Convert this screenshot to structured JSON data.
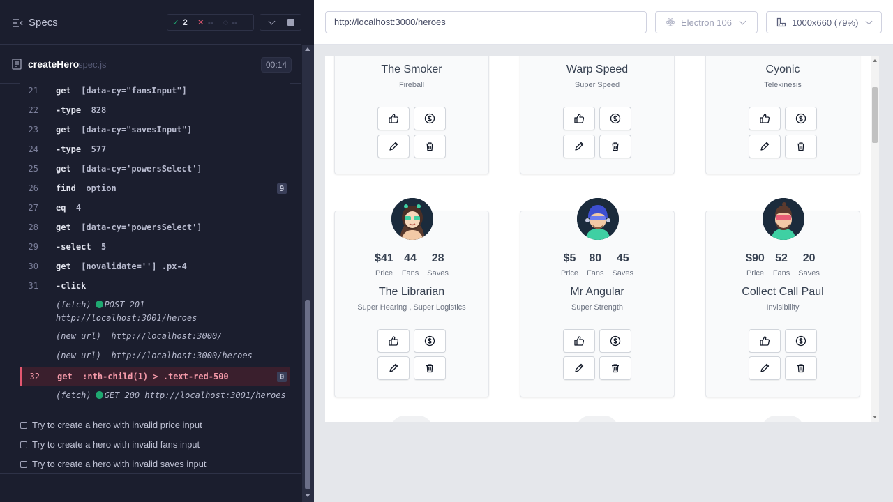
{
  "reporter": {
    "specs_label": "Specs",
    "stats": {
      "passed": "2",
      "failed": "--",
      "pending": "--"
    },
    "spec": {
      "name": "createHero",
      "ext": "spec.js",
      "time": "00:14"
    },
    "commands": [
      {
        "num": "21",
        "name": "get",
        "msg": "[data-cy=\"fansInput\"]"
      },
      {
        "num": "22",
        "name": "-type",
        "msg": "828"
      },
      {
        "num": "23",
        "name": "get",
        "msg": "[data-cy=\"savesInput\"]"
      },
      {
        "num": "24",
        "name": "-type",
        "msg": "577"
      },
      {
        "num": "25",
        "name": "get",
        "msg": "[data-cy='powersSelect']"
      },
      {
        "num": "26",
        "name": "find",
        "msg": "option",
        "badge": "9"
      },
      {
        "num": "27",
        "name": "eq",
        "msg": "4"
      },
      {
        "num": "28",
        "name": "get",
        "msg": "[data-cy='powersSelect']"
      },
      {
        "num": "29",
        "name": "-select",
        "msg": "5"
      },
      {
        "num": "30",
        "name": "get",
        "msg": "[novalidate=''] .px-4"
      },
      {
        "num": "31",
        "name": "-click",
        "msg": ""
      },
      {
        "num": "32",
        "name": "get",
        "msg": ":nth-child(1) > .text-red-500",
        "badge": "0"
      }
    ],
    "subs": {
      "fetch1_tag": "(fetch)",
      "fetch1_req": "POST 201",
      "fetch1_url": "http://localhost:3001/heroes",
      "newurl1_tag": "(new url)",
      "newurl1_url": "http://localhost:3000/",
      "newurl2_tag": "(new url)",
      "newurl2_url": "http://localhost:3000/heroes",
      "fetch2_tag": "(fetch)",
      "fetch2_req": "GET 200 http://localhost:3001/heroes"
    },
    "tests": [
      "Try to create a hero with invalid price input",
      "Try to create a hero with invalid fans input",
      "Try to create a hero with invalid saves input"
    ]
  },
  "preview": {
    "url": "http://localhost:3000/heroes",
    "browser": "Electron 106",
    "viewport": "1000x660  (79%)",
    "heroes_top": [
      {
        "name": "The Smoker",
        "powers": "Fireball"
      },
      {
        "name": "Warp Speed",
        "powers": "Super Speed"
      },
      {
        "name": "Cyonic",
        "powers": "Telekinesis"
      }
    ],
    "heroes": [
      {
        "name": "The Librarian",
        "powers": "Super Hearing ,  Super Logistics",
        "price": "$41",
        "fans": "44",
        "saves": "28"
      },
      {
        "name": "Mr Angular",
        "powers": "Super Strength",
        "price": "$5",
        "fans": "80",
        "saves": "45"
      },
      {
        "name": "Collect Call Paul",
        "powers": "Invisibility",
        "price": "$90",
        "fans": "52",
        "saves": "20"
      }
    ],
    "stat_labels": {
      "price": "Price",
      "fans": "Fans",
      "saves": "Saves"
    }
  }
}
